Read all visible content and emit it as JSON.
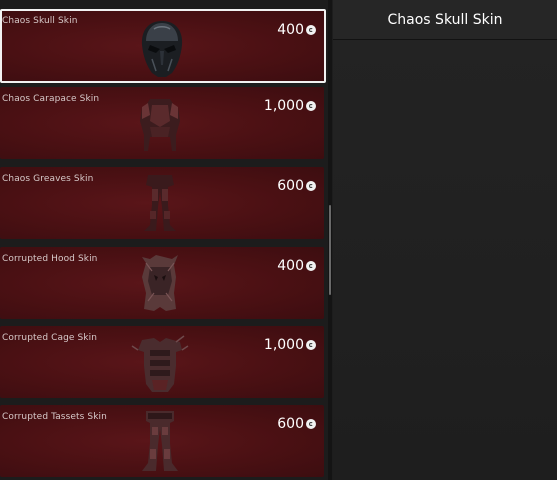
{
  "shop": {
    "items": [
      {
        "name": "Chaos Skull Skin",
        "price": "400",
        "icon": "chaos-skull-helmet-icon",
        "selected": true
      },
      {
        "name": "Chaos Carapace Skin",
        "price": "1,000",
        "icon": "chaos-carapace-armor-icon",
        "selected": false
      },
      {
        "name": "Chaos Greaves Skin",
        "price": "600",
        "icon": "chaos-greaves-legs-icon",
        "selected": false
      },
      {
        "name": "Corrupted Hood Skin",
        "price": "400",
        "icon": "corrupted-hood-icon",
        "selected": false
      },
      {
        "name": "Corrupted Cage Skin",
        "price": "1,000",
        "icon": "corrupted-cage-armor-icon",
        "selected": false
      },
      {
        "name": "Corrupted Tassets Skin",
        "price": "600",
        "icon": "corrupted-tassets-legs-icon",
        "selected": false
      }
    ],
    "currency_icon": "currency-coin-icon"
  },
  "detail": {
    "title": "Chaos Skull Skin"
  },
  "colors": {
    "card_background": "#4a1013",
    "selected_border": "#f2f2f2",
    "panel_background": "#1f1f1f"
  }
}
